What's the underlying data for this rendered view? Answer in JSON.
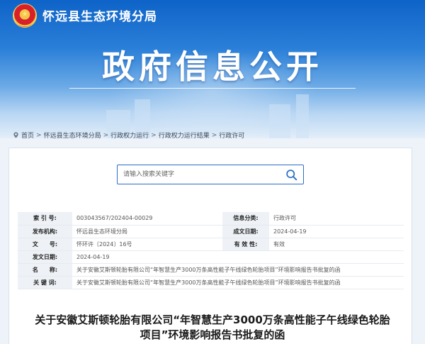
{
  "header": {
    "site_name": "怀远县生态环境分局",
    "banner_title": "政府信息公开"
  },
  "breadcrumb": {
    "items": [
      "首页",
      "怀远县生态环境分局",
      "行政权力运行",
      "行政权力运行结果",
      "行政许可"
    ],
    "separator": ">"
  },
  "search": {
    "placeholder": "请输入搜索关键字"
  },
  "meta": {
    "index_no_label": "索 引 号:",
    "index_no": "003043567/202404-00029",
    "category_label": "信息分类:",
    "category": "行政许可",
    "publisher_label": "发布机构:",
    "publisher": "怀远县生态环境分局",
    "created_label": "成文日期:",
    "created": "2024-04-19",
    "doc_no_label": "文　　号:",
    "doc_no": "怀环许〔2024〕16号",
    "validity_label": "有 效 性:",
    "validity": "有效",
    "published_label": "发文日期:",
    "published": "2024-04-19",
    "name_label": "名　　称:",
    "name": "关于安徽艾斯顿轮胎有限公司“年智慧生产3000万条高性能子午线绿色轮胎项目”环境影响报告书批复的函",
    "keywords_label": "关 键 词:",
    "keywords": "关于安徽艾斯顿轮胎有限公司“年智慧生产3000万条高性能子午线绿色轮胎项目”环境影响报告书批复的函"
  },
  "document": {
    "title_line1": "关于安徽艾斯顿轮胎有限公司“年智慧生产3000万条高性能子午线绿色轮胎",
    "title_line2": "项目”环境影响报告书批复的函"
  },
  "colors": {
    "banner_top": "#0e63c8",
    "accent": "#2a6fc4",
    "label_bg": "#eef1f5"
  }
}
